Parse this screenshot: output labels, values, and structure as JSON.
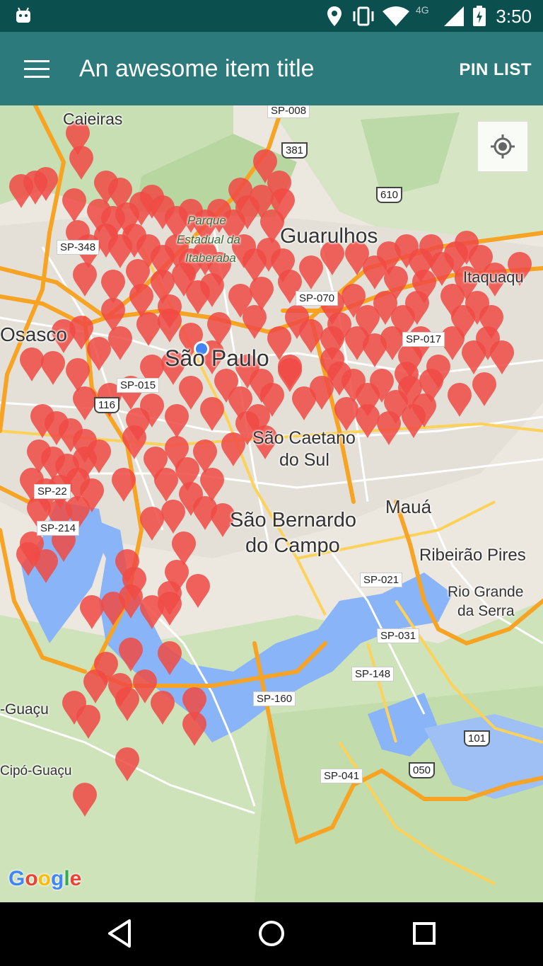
{
  "status_bar": {
    "time": "3:50",
    "network": "4G"
  },
  "app_bar": {
    "menu_icon": "hamburger-menu-icon",
    "title": "An awesome item title",
    "action": "PIN LIST"
  },
  "map": {
    "places": {
      "caieiras": "Caieiras",
      "guarulhos": "Guarulhos",
      "osasco": "Osasco",
      "sao_paulo": "São Paulo",
      "sao_caetano_1": "São Caetano",
      "sao_caetano_2": "do Sul",
      "maua": "Mauá",
      "sao_bernardo_1": "São Bernardo",
      "sao_bernardo_2": "do Campo",
      "ribeirao_pires": "Ribeirão Pires",
      "rio_grande_1": "Rio Grande",
      "rio_grande_2": "da Serra",
      "parque_1": "Parque",
      "parque_2": "Estadual da",
      "parque_3": "Itaberaba",
      "itaquaqu": "Itaquaqu",
      "guacu": "-Guaçu",
      "cipo_guacu": "Cipó-Guaçu"
    },
    "roads": {
      "sp008": "SP-008",
      "sp348": "SP-348",
      "sp070": "SP-070",
      "sp017": "SP-017",
      "sp015": "SP-015",
      "sp021": "SP-021",
      "sp031": "SP-031",
      "sp148": "SP-148",
      "sp160": "SP-160",
      "sp041": "SP-041",
      "sp214": "SP-214",
      "sp22": "SP-22"
    },
    "shields": {
      "br381": "381",
      "br610": "610",
      "br116": "116",
      "br101": "101",
      "br050": "050"
    },
    "pin_color": "#f04a45",
    "location_dot_color": "#4285f4",
    "attribution": "Google"
  },
  "nav_bar": {
    "back_icon": "back-triangle-icon",
    "home_icon": "home-circle-icon",
    "recents_icon": "recents-square-icon"
  }
}
